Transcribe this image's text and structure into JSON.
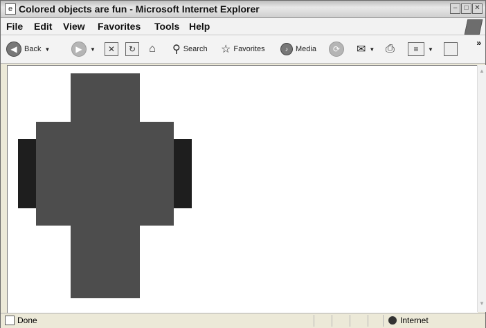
{
  "window": {
    "title": "Colored objects are fun - Microsoft Internet Explorer",
    "minimize_glyph": "–",
    "maximize_glyph": "□",
    "close_glyph": "✕"
  },
  "menu": [
    "File",
    "Edit",
    "View",
    "Favorites",
    "Tools",
    "Help"
  ],
  "toolbar": {
    "back_label": "Back",
    "search_label": "Search",
    "favorites_label": "Favorites",
    "media_label": "Media",
    "overflow_glyph": "»"
  },
  "page": {
    "background": "#ffffff",
    "shapes": [
      {
        "name": "top-gray-block",
        "color": "#4d4d4d"
      },
      {
        "name": "middle-gray-block",
        "color": "#4d4d4d"
      },
      {
        "name": "left-black-block",
        "color": "#1e1e1e"
      },
      {
        "name": "right-black-block",
        "color": "#1e1e1e"
      }
    ]
  },
  "status": {
    "text": "Done",
    "zone": "Internet"
  }
}
